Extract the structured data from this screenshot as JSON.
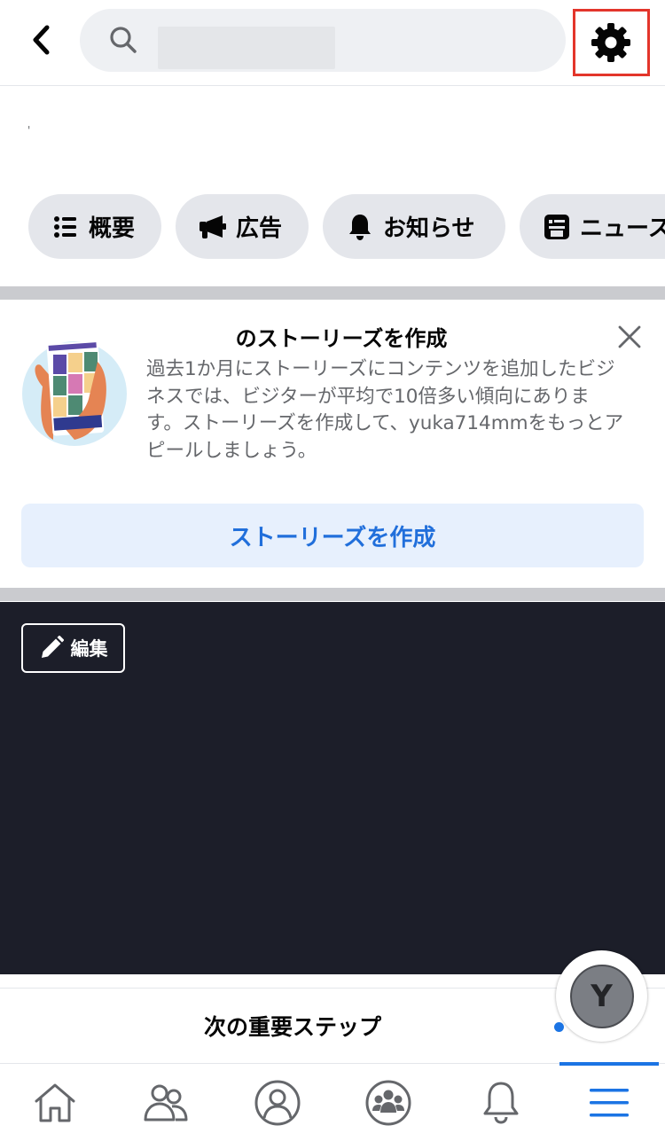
{
  "header": {
    "back_icon": "chevron-left-icon",
    "search_icon": "search-icon",
    "search_value": "",
    "settings_icon": "gear-icon",
    "highlight_color": "#e3352b"
  },
  "small_mark": "'",
  "chips": [
    {
      "label": "概要",
      "icon": "list-icon"
    },
    {
      "label": "広告",
      "icon": "megaphone-icon"
    },
    {
      "label": "お知らせ",
      "icon": "bell-icon"
    },
    {
      "label": "ニュース",
      "icon": "news-feed-icon"
    }
  ],
  "stories_card": {
    "title": "のストーリーズを作成",
    "description": "過去1か月にストーリーズにコンテンツを追加したビジネスでは、ビジターが平均で10倍多い傾向にあります。ストーリーズを作成して、yuka714mmをもっとアピールしましょう。",
    "cta_label": "ストーリーズを作成",
    "close_icon": "close-icon",
    "cta_color": "#216fdb"
  },
  "cover": {
    "edit_label": "編集",
    "edit_icon": "pencil-icon",
    "background": "#1c1e29"
  },
  "next_steps": {
    "label": "次の重要ステップ"
  },
  "avatar": {
    "initial": "Y"
  },
  "bottom_nav": {
    "items": [
      {
        "icon": "home-icon"
      },
      {
        "icon": "friends-icon"
      },
      {
        "icon": "profile-icon"
      },
      {
        "icon": "groups-icon"
      },
      {
        "icon": "notifications-bell-icon"
      },
      {
        "icon": "menu-icon"
      }
    ],
    "active_color": "#1b74e4"
  }
}
